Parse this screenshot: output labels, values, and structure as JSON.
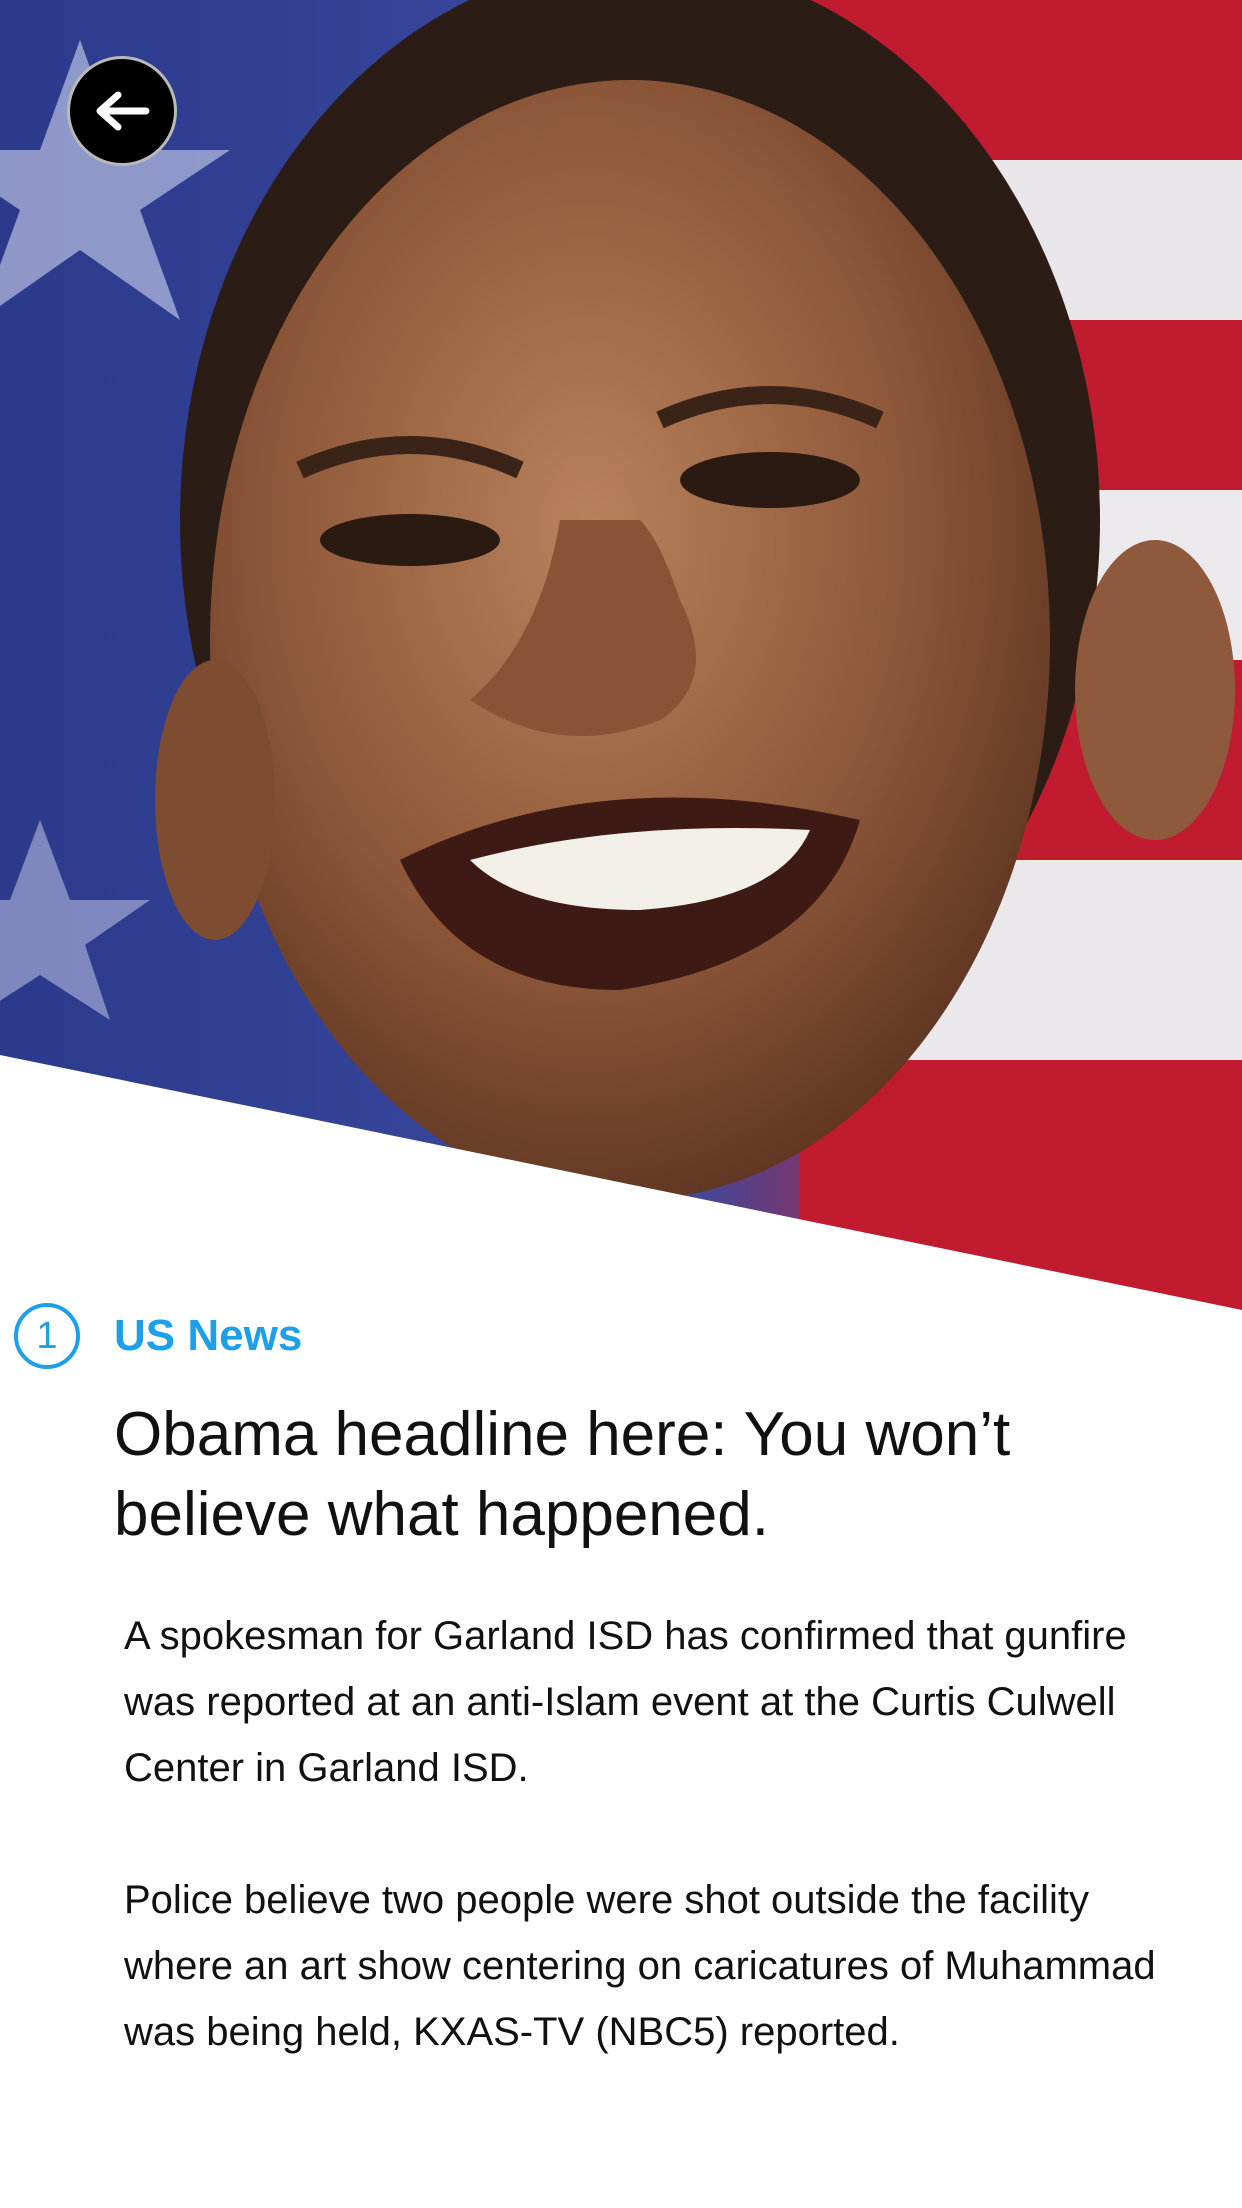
{
  "header": {
    "back_icon": "back-arrow-icon"
  },
  "article": {
    "number": "1",
    "category": "US News",
    "headline": "Obama headline here: You won’t believe what happened.",
    "paragraphs": [
      "A spokesman for Garland ISD has confirmed that gunfire was reported at an anti-Islam event at the Curtis Culwell Center in Garland ISD.",
      "Police believe two people were shot outside the facility where an art show centering on caricatures of Muhammad was being held, KXAS-TV (NBC5) reported."
    ]
  },
  "colors": {
    "accent": "#1e9fe8",
    "text": "#111111",
    "background": "#ffffff"
  }
}
